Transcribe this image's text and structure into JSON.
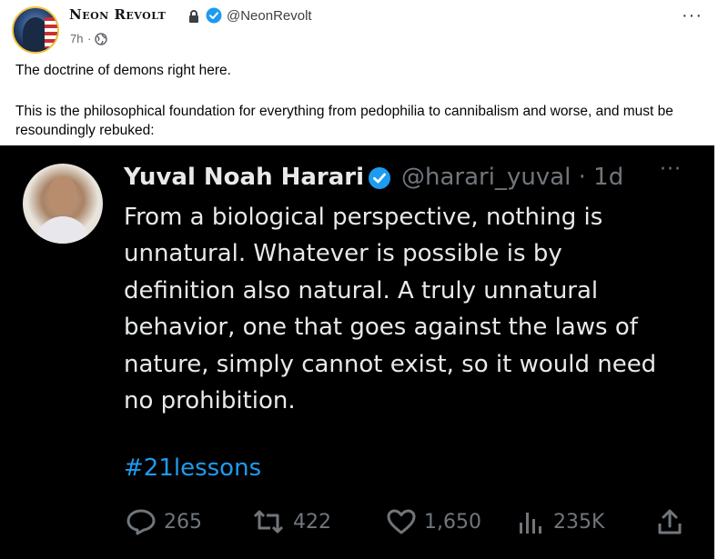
{
  "post": {
    "author_name": "Neon Revolt",
    "handle": "@NeonRevolt",
    "time": "7h",
    "separator": "·",
    "more": "···",
    "text_line1": "The doctrine of demons right here.",
    "text_line2": "This is the philosophical foundation for everything from pedophilia to cannibalism and worse, and must be resoundingly rebuked:"
  },
  "quoted_tweet": {
    "author_name": "Yuval Noah Harari",
    "handle_time": "@harari_yuval · 1d",
    "more": "···",
    "body_lines": [
      "From a biological perspective, nothing is",
      "unnatural. Whatever is possible is by",
      "definition also natural. A truly unnatural",
      "behavior, one that goes against the laws of",
      "nature, simply cannot exist, so it would need",
      "no prohibition."
    ],
    "hashtag": "#21lessons",
    "replies": "265",
    "retweets": "422",
    "likes": "1,650",
    "views": "235K"
  },
  "colors": {
    "accent": "#1d9bf0",
    "dark_bg": "#000000",
    "muted": "#71767b"
  },
  "icons": [
    "avatar",
    "lock-icon",
    "verified-icon",
    "globe-icon",
    "more-icon",
    "reply-icon",
    "retweet-icon",
    "like-icon",
    "views-icon",
    "share-icon"
  ]
}
